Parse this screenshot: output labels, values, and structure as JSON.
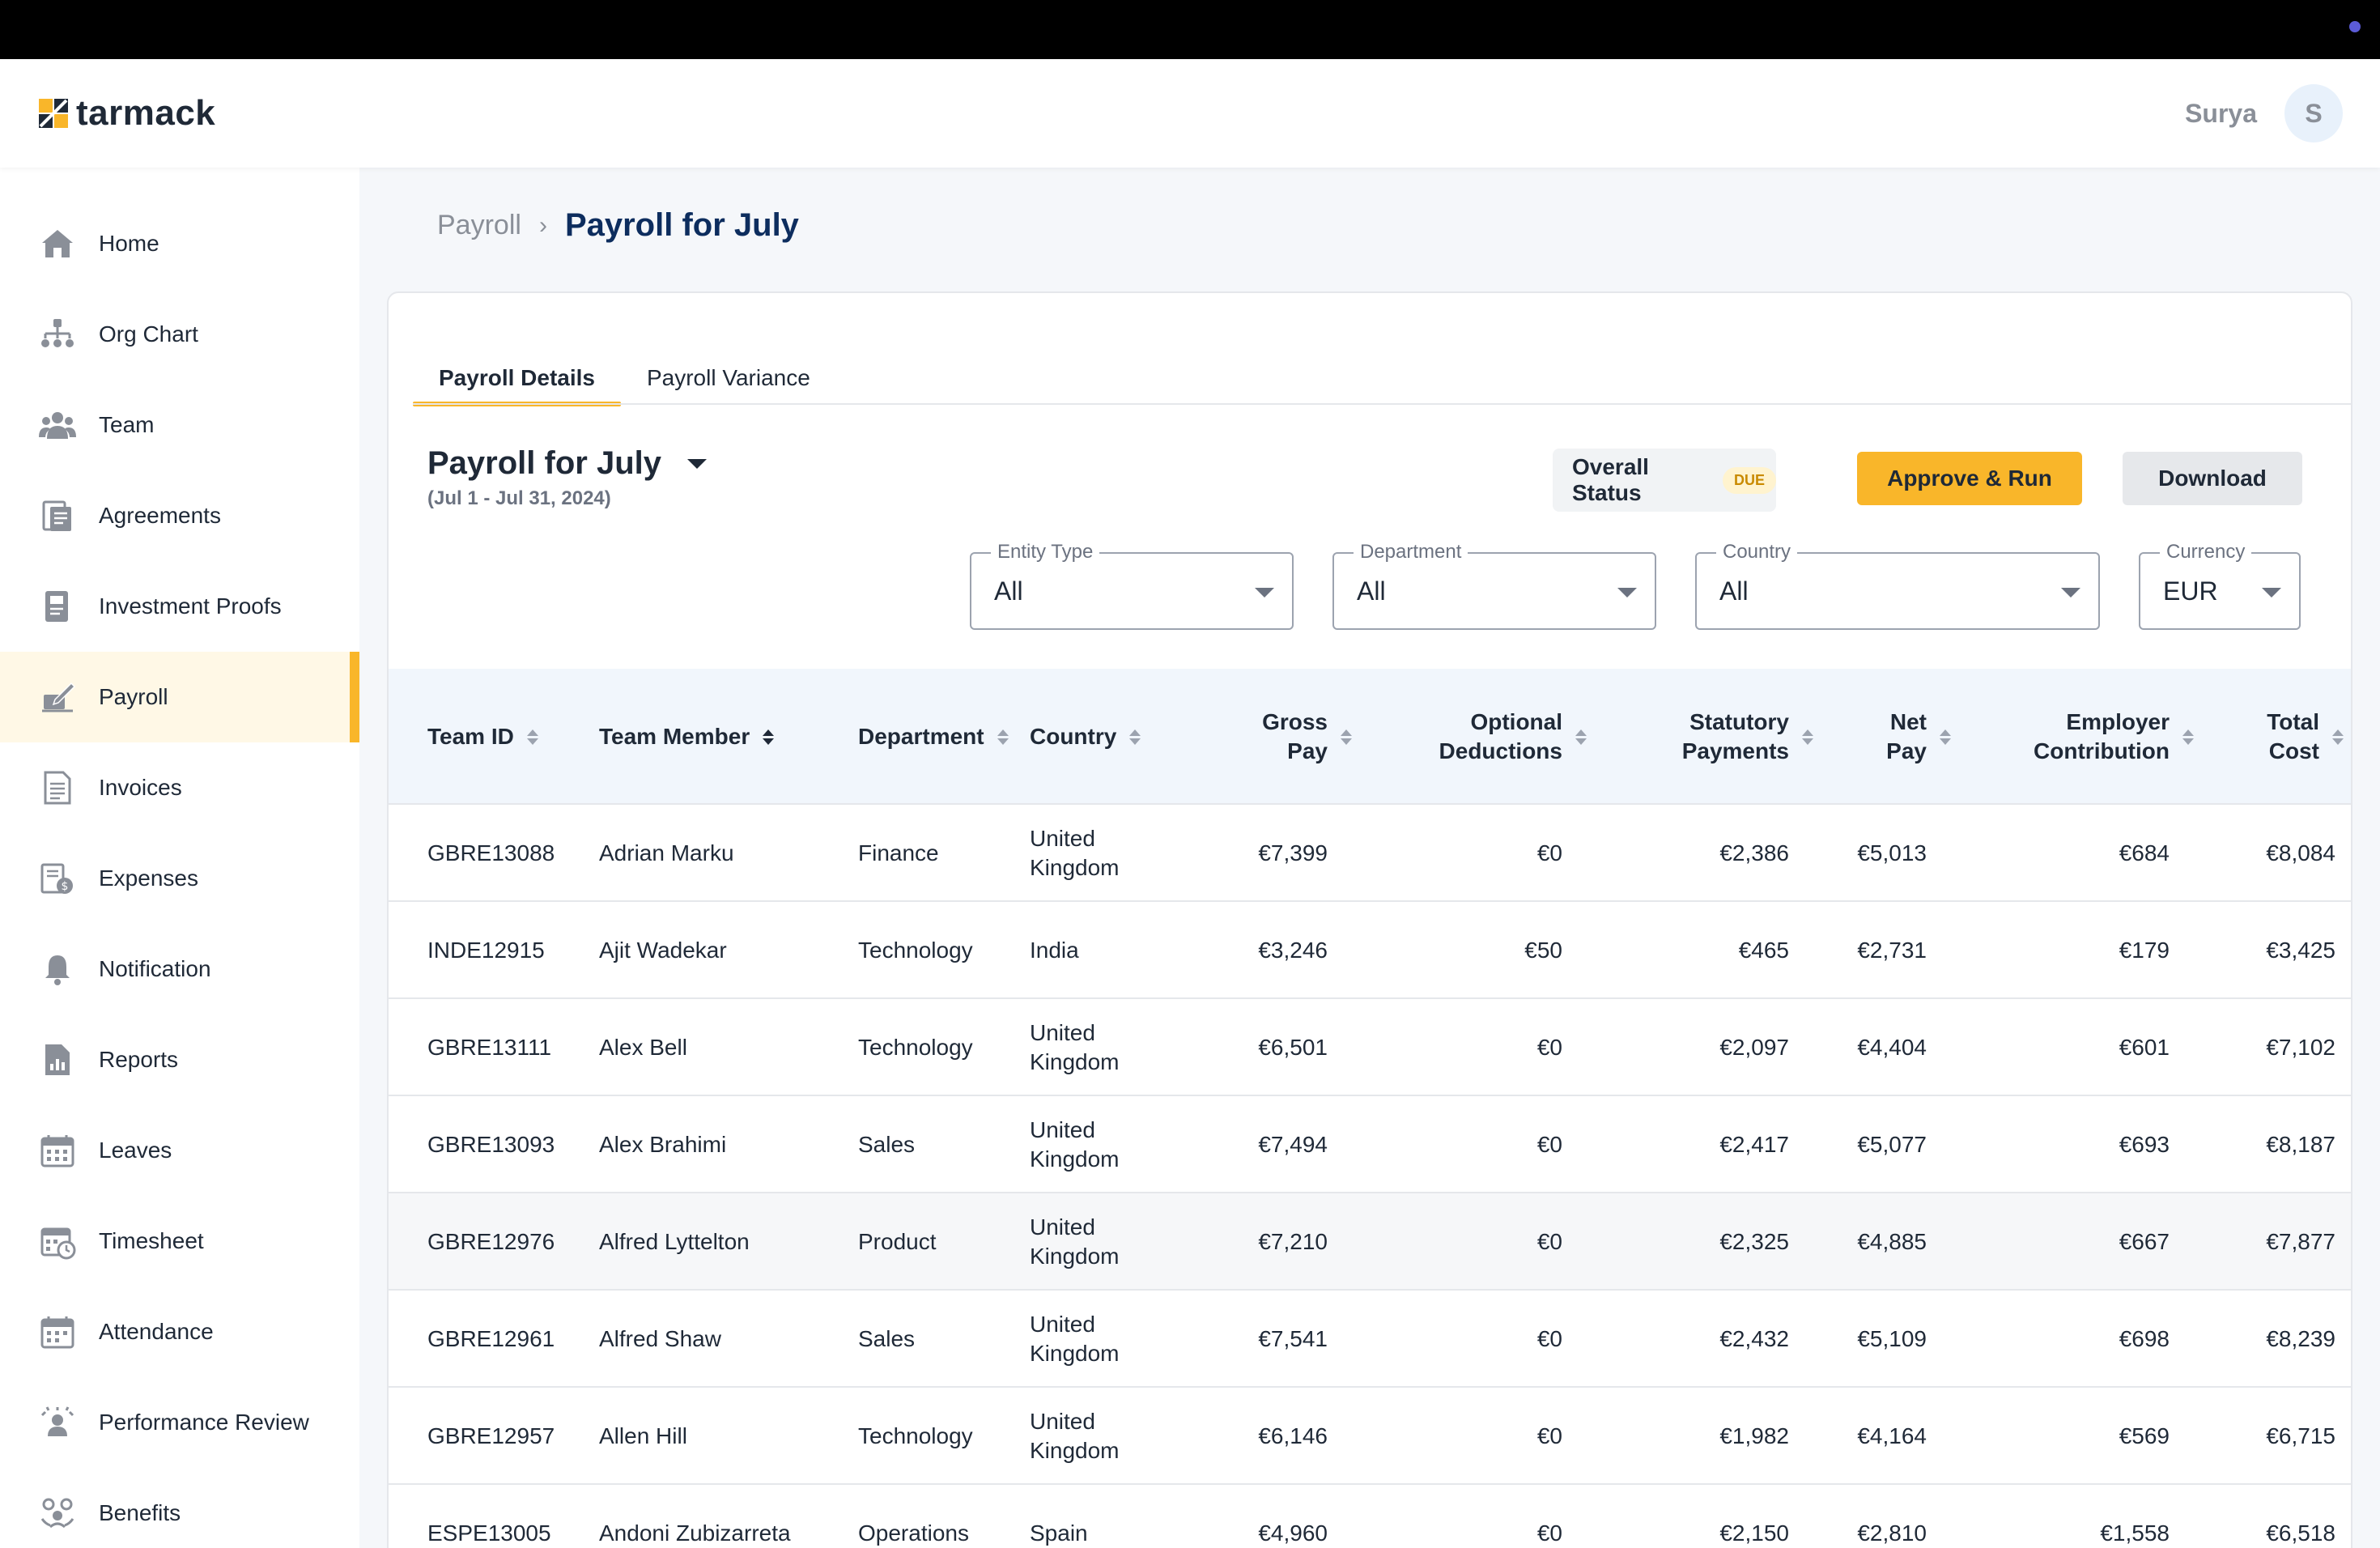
{
  "brand": {
    "name": "tarmack"
  },
  "user": {
    "name": "Surya",
    "initial": "S"
  },
  "sidebar": {
    "items": [
      {
        "label": "Home",
        "icon": "home-icon",
        "active": false
      },
      {
        "label": "Org Chart",
        "icon": "org-chart-icon",
        "active": false
      },
      {
        "label": "Team",
        "icon": "team-icon",
        "active": false
      },
      {
        "label": "Agreements",
        "icon": "agreements-icon",
        "active": false
      },
      {
        "label": "Investment Proofs",
        "icon": "investment-proofs-icon",
        "active": false
      },
      {
        "label": "Payroll",
        "icon": "payroll-icon",
        "active": true
      },
      {
        "label": "Invoices",
        "icon": "invoices-icon",
        "active": false
      },
      {
        "label": "Expenses",
        "icon": "expenses-icon",
        "active": false
      },
      {
        "label": "Notification",
        "icon": "bell-icon",
        "active": false
      },
      {
        "label": "Reports",
        "icon": "reports-icon",
        "active": false
      },
      {
        "label": "Leaves",
        "icon": "calendar-icon",
        "active": false
      },
      {
        "label": "Timesheet",
        "icon": "timesheet-icon",
        "active": false
      },
      {
        "label": "Attendance",
        "icon": "attendance-icon",
        "active": false
      },
      {
        "label": "Performance Review",
        "icon": "performance-review-icon",
        "active": false
      },
      {
        "label": "Benefits",
        "icon": "benefits-icon",
        "active": false
      }
    ]
  },
  "breadcrumb": {
    "root": "Payroll",
    "separator": "›",
    "current": "Payroll for July"
  },
  "tabs": [
    {
      "label": "Payroll Details",
      "active": true
    },
    {
      "label": "Payroll Variance",
      "active": false
    }
  ],
  "payroll": {
    "title": "Payroll for July",
    "dates": "(Jul 1 - Jul 31, 2024)",
    "status_label": "Overall Status",
    "status_badge": "DUE",
    "approve_label": "Approve & Run",
    "download_label": "Download"
  },
  "filters": [
    {
      "label": "Entity Type",
      "value": "All"
    },
    {
      "label": "Department",
      "value": "All"
    },
    {
      "label": "Country",
      "value": "All"
    },
    {
      "label": "Currency",
      "value": "EUR"
    }
  ],
  "table": {
    "columns": [
      {
        "label1": "Team ID",
        "label2": "",
        "sort": "none"
      },
      {
        "label1": "Team Member",
        "label2": "",
        "sort": "asc"
      },
      {
        "label1": "Department",
        "label2": "",
        "sort": "none"
      },
      {
        "label1": "Country",
        "label2": "",
        "sort": "none"
      },
      {
        "label1": "Gross",
        "label2": "Pay",
        "sort": "none"
      },
      {
        "label1": "Optional",
        "label2": "Deductions",
        "sort": "none"
      },
      {
        "label1": "Statutory",
        "label2": "Payments",
        "sort": "none"
      },
      {
        "label1": "Net",
        "label2": "Pay",
        "sort": "none"
      },
      {
        "label1": "Employer",
        "label2": "Contribution",
        "sort": "none"
      },
      {
        "label1": "Total",
        "label2": "Cost",
        "sort": "none"
      }
    ],
    "rows": [
      {
        "id": "GBRE13088",
        "member": "Adrian Marku",
        "department": "Finance",
        "country1": "United",
        "country2": "Kingdom",
        "gross": "€7,399",
        "optional": "€0",
        "statutory": "€2,386",
        "net": "€5,013",
        "employer": "€684",
        "total": "€8,084"
      },
      {
        "id": "INDE12915",
        "member": "Ajit Wadekar",
        "department": "Technology",
        "country1": "India",
        "country2": "",
        "gross": "€3,246",
        "optional": "€50",
        "statutory": "€465",
        "net": "€2,731",
        "employer": "€179",
        "total": "€3,425"
      },
      {
        "id": "GBRE13111",
        "member": "Alex Bell",
        "department": "Technology",
        "country1": "United",
        "country2": "Kingdom",
        "gross": "€6,501",
        "optional": "€0",
        "statutory": "€2,097",
        "net": "€4,404",
        "employer": "€601",
        "total": "€7,102"
      },
      {
        "id": "GBRE13093",
        "member": "Alex Brahimi",
        "department": "Sales",
        "country1": "United",
        "country2": "Kingdom",
        "gross": "€7,494",
        "optional": "€0",
        "statutory": "€2,417",
        "net": "€5,077",
        "employer": "€693",
        "total": "€8,187"
      },
      {
        "id": "GBRE12976",
        "member": "Alfred Lyttelton",
        "department": "Product",
        "country1": "United",
        "country2": "Kingdom",
        "gross": "€7,210",
        "optional": "€0",
        "statutory": "€2,325",
        "net": "€4,885",
        "employer": "€667",
        "total": "€7,877"
      },
      {
        "id": "GBRE12961",
        "member": "Alfred Shaw",
        "department": "Sales",
        "country1": "United",
        "country2": "Kingdom",
        "gross": "€7,541",
        "optional": "€0",
        "statutory": "€2,432",
        "net": "€5,109",
        "employer": "€698",
        "total": "€8,239"
      },
      {
        "id": "GBRE12957",
        "member": "Allen Hill",
        "department": "Technology",
        "country1": "United",
        "country2": "Kingdom",
        "gross": "€6,146",
        "optional": "€0",
        "statutory": "€1,982",
        "net": "€4,164",
        "employer": "€569",
        "total": "€6,715"
      },
      {
        "id": "ESPE13005",
        "member": "Andoni Zubizarreta",
        "department": "Operations",
        "country1": "Spain",
        "country2": "",
        "gross": "€4,960",
        "optional": "€0",
        "statutory": "€2,150",
        "net": "€2,810",
        "employer": "€1,558",
        "total": "€6,518"
      }
    ]
  },
  "colors": {
    "accent": "#f9b62a",
    "title": "#0d2d5e",
    "badge_text": "#c98a00"
  }
}
